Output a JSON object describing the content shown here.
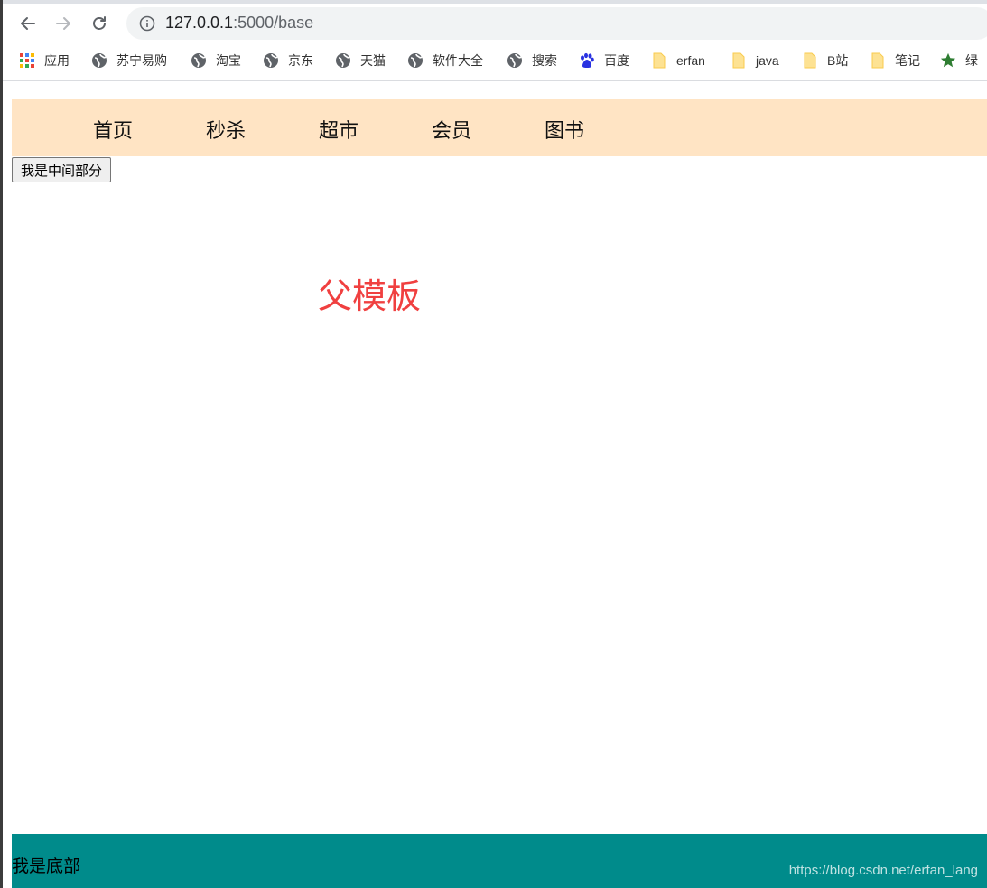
{
  "browser": {
    "url_host": "127.0.0.1",
    "url_path": ":5000/base",
    "bookmarks": [
      {
        "label": "应用",
        "icon": "apps-grid-icon"
      },
      {
        "label": "苏宁易购",
        "icon": "globe-icon"
      },
      {
        "label": "淘宝",
        "icon": "globe-icon"
      },
      {
        "label": "京东",
        "icon": "globe-icon"
      },
      {
        "label": "天猫",
        "icon": "globe-icon"
      },
      {
        "label": "软件大全",
        "icon": "globe-icon"
      },
      {
        "label": "搜索",
        "icon": "globe-icon"
      },
      {
        "label": "百度",
        "icon": "baidu-paw-icon"
      },
      {
        "label": "erfan",
        "icon": "folder-icon"
      },
      {
        "label": "java",
        "icon": "folder-icon"
      },
      {
        "label": "B站",
        "icon": "folder-icon"
      },
      {
        "label": "笔记",
        "icon": "folder-icon"
      },
      {
        "label": "绿",
        "icon": "star-icon"
      }
    ]
  },
  "page": {
    "menu": [
      "首页",
      "秒杀",
      "超市",
      "会员",
      "图书"
    ],
    "middle_button": "我是中间部分",
    "title": "父模板",
    "footer_text": "我是底部",
    "watermark": "https://blog.csdn.net/erfan_lang"
  },
  "colors": {
    "menu_bg": "#ffe4c4",
    "title": "#f04040",
    "footer_bg": "#008b8b"
  }
}
